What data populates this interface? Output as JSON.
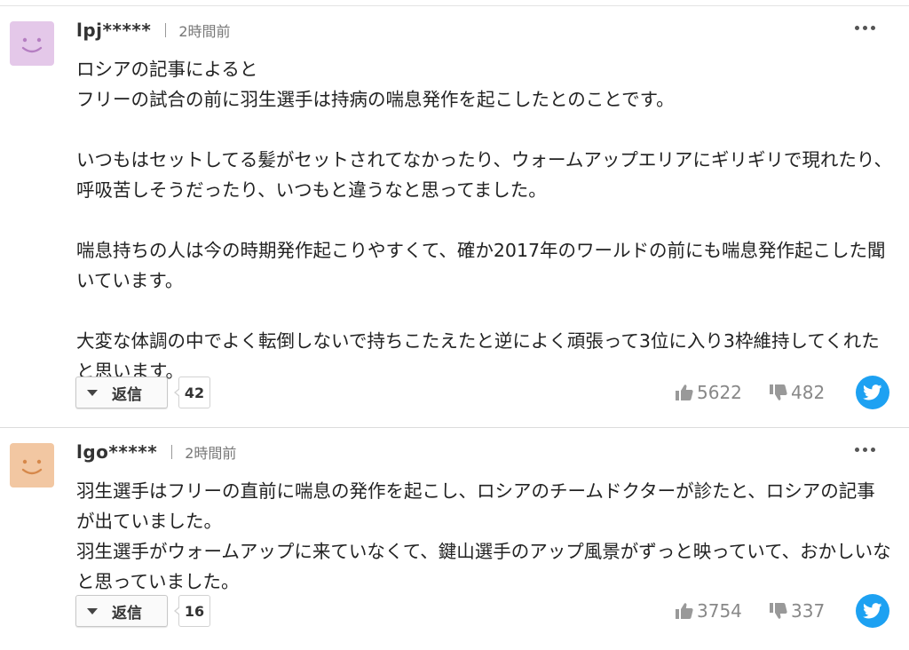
{
  "comments": [
    {
      "username": "lpj*****",
      "time": "2時間前",
      "avatar_color": "#e4c8e9",
      "body": "ロシアの記事によると\nフリーの試合の前に羽生選手は持病の喘息発作を起こしたとのことです。\n\nいつもはセットしてる髪がセットされてなかったり、ウォームアップエリアにギリギリで現れたり、呼吸苦しそうだったり、いつもと違うなと思ってました。\n\n喘息持ちの人は今の時期発作起こりやすくて、確か2017年のワールドの前にも喘息発作起こした聞いています。\n\n大変な体調の中でよく転倒しないで持ちこたえたと逆によく頑張って3位に入り3枠維持してくれたと思います。",
      "reply_label": "返信",
      "reply_count": "42",
      "likes": "5622",
      "dislikes": "482"
    },
    {
      "username": "lgo*****",
      "time": "2時間前",
      "avatar_color": "#f2c7a2",
      "body": "羽生選手はフリーの直前に喘息の発作を起こし、ロシアのチームドクターが診たと、ロシアの記事が出ていました。\n羽生選手がウォームアップに来ていなくて、鍵山選手のアップ風景がずっと映っていて、おかしいなと思っていました。",
      "reply_label": "返信",
      "reply_count": "16",
      "likes": "3754",
      "dislikes": "337"
    }
  ],
  "icons": {
    "more": "more-dots-icon",
    "like": "thumbs-up-icon",
    "dislike": "thumbs-down-icon",
    "share": "twitter-icon",
    "reply": "triangle-down-icon"
  },
  "colors": {
    "twitter": "#1da1f2",
    "muted": "#888888"
  }
}
